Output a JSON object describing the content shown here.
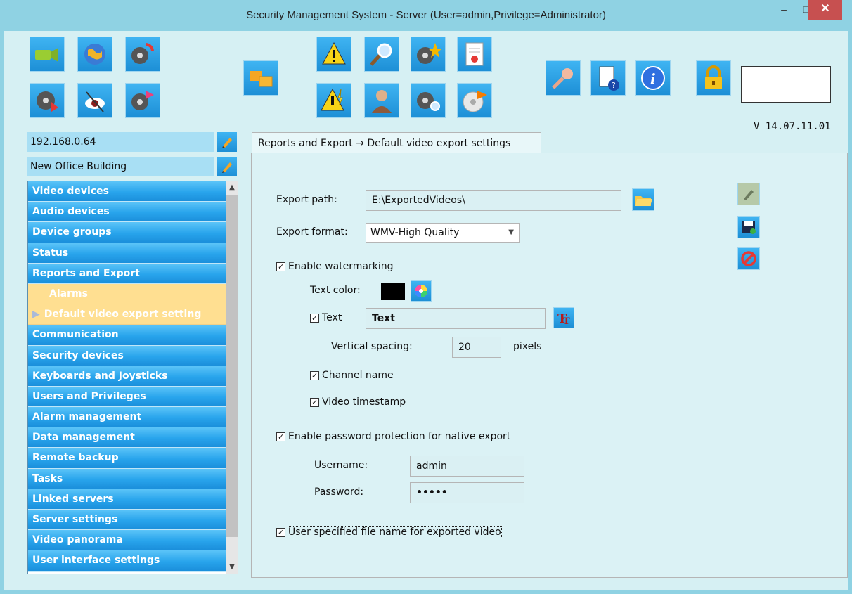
{
  "window": {
    "title": "Security Management System - Server (User=admin,Privilege=Administrator)",
    "controls": {
      "minimize": "–",
      "maximize": "□",
      "close": "✕"
    }
  },
  "toolbar": {
    "version": "V 14.07.11.01",
    "icons": [
      "camera-icon",
      "globe-icon",
      "film-refresh-icon",
      "film-play-icon",
      "eye-icon",
      "film-export-icon",
      "windows-icon",
      "warning-icon",
      "search-icon",
      "film-star-icon",
      "report-icon",
      "warning-bolt-icon",
      "user-icon",
      "film-search-icon",
      "disc-export-icon",
      "key-icon",
      "help-doc-icon",
      "info-icon",
      "lock-icon"
    ]
  },
  "server": {
    "address": "192.168.0.64",
    "site_name": "New Office Building"
  },
  "nav": {
    "items": [
      "Video devices",
      "Audio devices",
      "Device groups",
      "Status",
      "Reports and Export"
    ],
    "sub_items": [
      "Alarms",
      "Default video export setting"
    ],
    "items_after": [
      "Communication",
      "Security devices",
      "Keyboards and Joysticks",
      "Users and Privileges",
      "Alarm management",
      "Data management",
      "Remote backup",
      "Tasks",
      "Linked servers",
      "Server settings",
      "Video panorama",
      "User interface settings"
    ]
  },
  "tab": {
    "label": "Reports and Export → Default video export settings"
  },
  "form": {
    "export_path_label": "Export path:",
    "export_path_value": "E:\\ExportedVideos\\",
    "export_format_label": "Export format:",
    "export_format_value": "WMV-High Quality",
    "enable_watermarking": "Enable watermarking",
    "text_color_label": "Text color:",
    "text_color": "#000000",
    "text_label": "Text",
    "text_value": "Text",
    "vertical_spacing_label": "Vertical spacing:",
    "vertical_spacing_value": "20",
    "vertical_spacing_unit": "pixels",
    "channel_name": "Channel name",
    "video_timestamp": "Video timestamp",
    "enable_password": "Enable password protection for native export",
    "username_label": "Username:",
    "username_value": "admin",
    "password_label": "Password:",
    "password_value": "•••••",
    "user_filename": "User specified file name for exported video"
  }
}
